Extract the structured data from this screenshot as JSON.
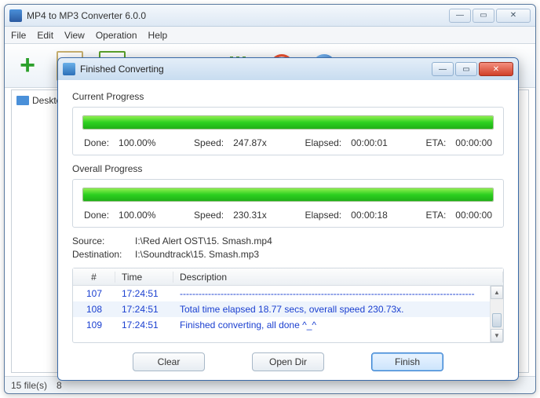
{
  "main": {
    "title": "MP4 to MP3 Converter 6.0.0",
    "menu": [
      "File",
      "Edit",
      "View",
      "Operation",
      "Help"
    ],
    "tree_item": "Desktop",
    "status": {
      "files": "15 file(s)",
      "extra": "8"
    }
  },
  "dialog": {
    "title": "Finished Converting",
    "current": {
      "label": "Current Progress",
      "done_lbl": "Done:",
      "done": "100.00%",
      "speed_lbl": "Speed:",
      "speed": "247.87x",
      "elapsed_lbl": "Elapsed:",
      "elapsed": "00:00:01",
      "eta_lbl": "ETA:",
      "eta": "00:00:00",
      "pct": 100
    },
    "overall": {
      "label": "Overall Progress",
      "done_lbl": "Done:",
      "done": "100.00%",
      "speed_lbl": "Speed:",
      "speed": "230.31x",
      "elapsed_lbl": "Elapsed:",
      "elapsed": "00:00:18",
      "eta_lbl": "ETA:",
      "eta": "00:00:00",
      "pct": 100
    },
    "source_lbl": "Source:",
    "source": "I:\\Red Alert OST\\15. Smash.mp4",
    "dest_lbl": "Destination:",
    "dest": "I:\\Soundtrack\\15. Smash.mp3",
    "log": {
      "headers": {
        "n": "#",
        "time": "Time",
        "desc": "Description"
      },
      "rows": [
        {
          "n": "107",
          "time": "17:24:51",
          "desc": "----------------------------------------------------------------------------------------------"
        },
        {
          "n": "108",
          "time": "17:24:51",
          "desc": "Total time elapsed 18.77 secs, overall speed 230.73x."
        },
        {
          "n": "109",
          "time": "17:24:51",
          "desc": "Finished converting, all done ^_^"
        }
      ]
    },
    "buttons": {
      "clear": "Clear",
      "open": "Open Dir",
      "finish": "Finish"
    }
  }
}
